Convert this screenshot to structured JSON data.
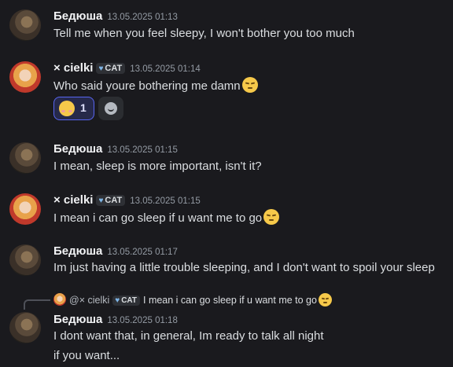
{
  "messages": [
    {
      "author": "Бедюша",
      "timestamp": "13.05.2025 01:13",
      "text": "Tell me when you feel sleepy, I won't bother you too much"
    },
    {
      "author": "× cielki",
      "tag": "CAT",
      "timestamp": "13.05.2025 01:14",
      "text": "Who said youre bothering me damn",
      "emoji": "pensive-emoji",
      "reactions": [
        {
          "emoji": "relieved-emoji",
          "count": "1"
        }
      ]
    },
    {
      "author": "Бедюша",
      "timestamp": "13.05.2025 01:15",
      "text": "I mean, sleep is more important, isn't it?"
    },
    {
      "author": "× cielki",
      "tag": "CAT",
      "timestamp": "13.05.2025 01:15",
      "text": "I mean i can go sleep if u want me to go",
      "emoji": "pensive-emoji"
    },
    {
      "author": "Бедюша",
      "timestamp": "13.05.2025 01:17",
      "text": "Im just having a little trouble sleeping, and I don't want to spoil your sleep"
    },
    {
      "author": "Бедюша",
      "timestamp": "13.05.2025 01:18",
      "reply": {
        "author": "@× cielki",
        "tag": "CAT",
        "text": "I mean i can go sleep if u want me to go"
      },
      "text": "I dont want that, in general, Im ready to talk all night",
      "text2": "if you want..."
    }
  ],
  "colors": {
    "background": "#1a1a1e",
    "accent": "#5865f2",
    "text": "#dbdee1",
    "muted": "#949ba4"
  }
}
